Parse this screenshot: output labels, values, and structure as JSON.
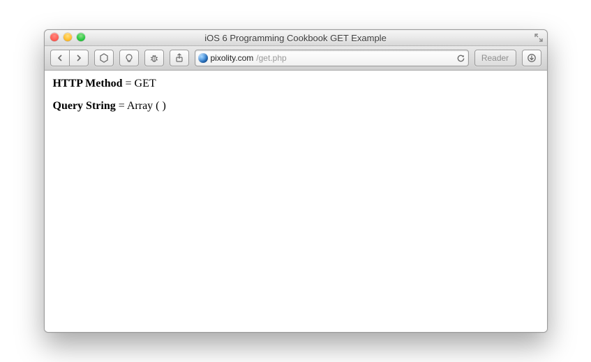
{
  "window": {
    "title": "iOS 6 Programming Cookbook GET Example"
  },
  "address": {
    "host": "pixolity.com",
    "path": "/get.php"
  },
  "toolbar": {
    "reader_label": "Reader"
  },
  "body": {
    "line1_label": "HTTP Method",
    "line1_value": "GET",
    "line2_label": "Query String",
    "line2_value": "Array ( )"
  }
}
